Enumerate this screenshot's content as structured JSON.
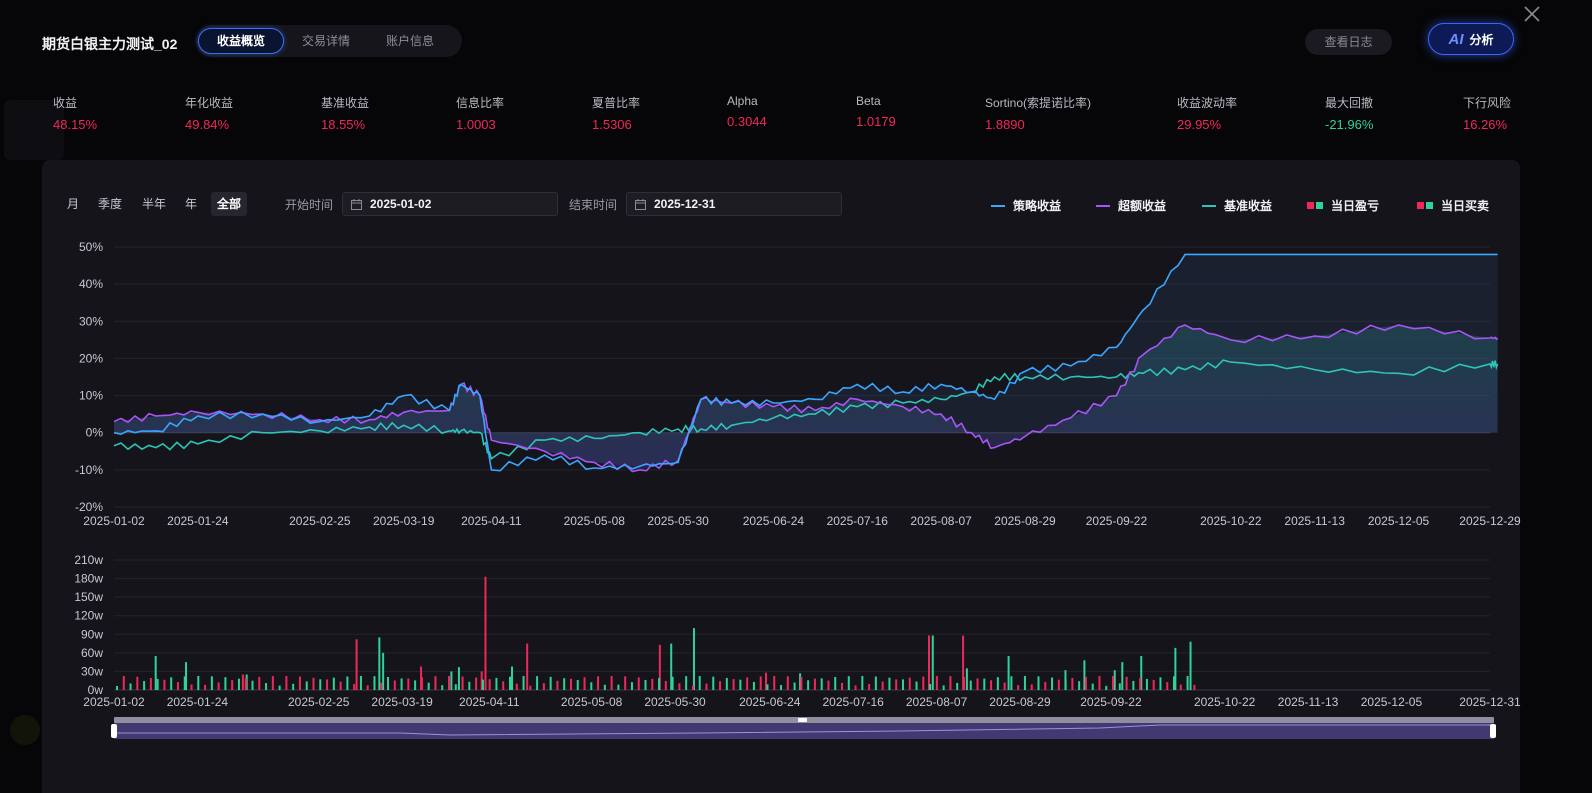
{
  "header": {
    "title": "期货白银主力测试_02",
    "tabs": [
      {
        "label": "收益概览",
        "active": true
      },
      {
        "label": "交易详情",
        "active": false
      },
      {
        "label": "账户信息",
        "active": false
      }
    ],
    "log_button": "查看日志",
    "ai_button": {
      "logo": "AI",
      "label": "分析"
    },
    "close_icon": "close-icon"
  },
  "metrics": [
    {
      "label": "收益",
      "value": "48.15%",
      "tone": "red"
    },
    {
      "label": "年化收益",
      "value": "49.84%",
      "tone": "red"
    },
    {
      "label": "基准收益",
      "value": "18.55%",
      "tone": "red"
    },
    {
      "label": "信息比率",
      "value": "1.0003",
      "tone": "red"
    },
    {
      "label": "夏普比率",
      "value": "1.5306",
      "tone": "red"
    },
    {
      "label": "Alpha",
      "value": "0.3044",
      "tone": "red"
    },
    {
      "label": "Beta",
      "value": "1.0179",
      "tone": "red"
    },
    {
      "label": "Sortino(索提诺比率)",
      "value": "1.8890",
      "tone": "red"
    },
    {
      "label": "收益波动率",
      "value": "29.95%",
      "tone": "red"
    },
    {
      "label": "最大回撤",
      "value": "-21.96%",
      "tone": "green"
    },
    {
      "label": "下行风险",
      "value": "16.26%",
      "tone": "red"
    }
  ],
  "controls": {
    "ranges": [
      {
        "label": "月",
        "active": false
      },
      {
        "label": "季度",
        "active": false
      },
      {
        "label": "半年",
        "active": false
      },
      {
        "label": "年",
        "active": false
      },
      {
        "label": "全部",
        "active": true
      }
    ],
    "start_label": "开始时间",
    "start_value": "2025-01-02",
    "end_label": "结束时间",
    "end_value": "2025-12-31",
    "calendar_icon": "calendar-icon"
  },
  "legend": [
    {
      "label": "策略收益",
      "kind": "line",
      "color": "#3aa6ff"
    },
    {
      "label": "超额收益",
      "kind": "line",
      "color": "#a855f7"
    },
    {
      "label": "基准收益",
      "kind": "line",
      "color": "#2ec4b6"
    },
    {
      "label": "当日盈亏",
      "kind": "squares",
      "colors": [
        "#f0285a",
        "#2fd399"
      ]
    },
    {
      "label": "当日买卖",
      "kind": "squares",
      "colors": [
        "#f0285a",
        "#2fd399"
      ]
    }
  ],
  "colors": {
    "strategy": "#3aa6ff",
    "excess": "#a855f7",
    "benchmark": "#2ec4b6",
    "up": "#f0285a",
    "down": "#2fd399"
  },
  "chart_data": [
    {
      "type": "line",
      "title": "",
      "xlabel": "",
      "ylabel": "",
      "ylim": [
        -20,
        50
      ],
      "y_ticks": [
        "50%",
        "40%",
        "30%",
        "20%",
        "10%",
        "0%",
        "-10%",
        "-20%"
      ],
      "x_ticks": [
        "2025-01-02",
        "2025-01-24",
        "2025-02-25",
        "2025-03-19",
        "2025-04-11",
        "2025-05-08",
        "2025-05-30",
        "2025-06-24",
        "2025-07-16",
        "2025-08-07",
        "2025-08-29",
        "2025-09-22",
        "2025-10-22",
        "2025-11-13",
        "2025-12-05",
        "2025-12-29"
      ],
      "x": [
        "2025-01-02",
        "2025-01-13",
        "2025-01-24",
        "2025-02-10",
        "2025-02-25",
        "2025-03-10",
        "2025-03-19",
        "2025-03-31",
        "2025-04-03",
        "2025-04-08",
        "2025-04-11",
        "2025-04-25",
        "2025-05-08",
        "2025-05-20",
        "2025-05-30",
        "2025-06-05",
        "2025-06-13",
        "2025-06-24",
        "2025-07-05",
        "2025-07-16",
        "2025-07-28",
        "2025-08-07",
        "2025-08-15",
        "2025-08-21",
        "2025-08-29",
        "2025-09-10",
        "2025-09-22",
        "2025-09-29",
        "2025-10-10",
        "2025-10-22",
        "2025-11-13",
        "2025-12-05",
        "2025-12-29",
        "2025-12-31"
      ],
      "series": [
        {
          "name": "策略收益",
          "values": [
            0,
            0.5,
            4.5,
            5,
            3,
            4.5,
            10,
            6,
            13,
            10,
            -10,
            -6,
            -9.5,
            -9,
            -8,
            9,
            8,
            8,
            9,
            13,
            11,
            13,
            11,
            9,
            16.5,
            18,
            23,
            33,
            48,
            48,
            48,
            48,
            48,
            48
          ]
        },
        {
          "name": "超额收益",
          "values": [
            3,
            4.5,
            5.5,
            5,
            3.5,
            3.5,
            5.5,
            6,
            13,
            10,
            -2,
            -5,
            -8,
            -10,
            -7.5,
            9,
            8,
            7,
            6,
            9,
            7,
            5,
            0,
            -4,
            -1,
            4,
            10,
            21,
            29,
            25,
            26,
            29,
            25.5,
            25.5
          ]
        },
        {
          "name": "基准收益",
          "values": [
            -3.5,
            -4,
            -3,
            0,
            0.5,
            1.5,
            2,
            0.5,
            0.5,
            0,
            -7,
            -2,
            -1.5,
            0,
            1,
            1,
            2,
            4,
            5,
            7,
            8,
            9,
            11,
            15,
            15,
            15,
            15,
            16,
            17,
            19,
            17,
            16,
            18.5,
            18.5
          ]
        }
      ]
    },
    {
      "type": "bar",
      "title": "",
      "xlabel": "",
      "ylabel": "",
      "ylim": [
        0,
        210
      ],
      "y_ticks": [
        "210w",
        "180w",
        "150w",
        "120w",
        "90w",
        "60w",
        "30w",
        "0w"
      ],
      "x_ticks": [
        "2025-01-02",
        "2025-01-24",
        "2025-02-25",
        "2025-03-19",
        "2025-04-11",
        "2025-05-08",
        "2025-05-30",
        "2025-06-24",
        "2025-07-16",
        "2025-08-07",
        "2025-08-29",
        "2025-09-22",
        "2025-10-22",
        "2025-11-13",
        "2025-12-05",
        "2025-12-31"
      ],
      "series": [
        {
          "name": "当日买卖",
          "values": [
            {
              "x": "2025-01-13",
              "v": 55,
              "side": "down"
            },
            {
              "x": "2025-01-21",
              "v": 45,
              "side": "down"
            },
            {
              "x": "2025-02-05",
              "v": 25,
              "side": "up"
            },
            {
              "x": "2025-02-06",
              "v": 25,
              "side": "down"
            },
            {
              "x": "2025-03-07",
              "v": 82,
              "side": "up"
            },
            {
              "x": "2025-03-13",
              "v": 85,
              "side": "down"
            },
            {
              "x": "2025-03-14",
              "v": 60,
              "side": "down"
            },
            {
              "x": "2025-03-24",
              "v": 38,
              "side": "up"
            },
            {
              "x": "2025-04-01",
              "v": 30,
              "side": "down"
            },
            {
              "x": "2025-04-03",
              "v": 37,
              "side": "down"
            },
            {
              "x": "2025-04-09",
              "v": 30,
              "side": "up"
            },
            {
              "x": "2025-04-10",
              "v": 183,
              "side": "up"
            },
            {
              "x": "2025-04-17",
              "v": 38,
              "side": "down"
            },
            {
              "x": "2025-04-21",
              "v": 75,
              "side": "up"
            },
            {
              "x": "2025-05-26",
              "v": 73,
              "side": "up"
            },
            {
              "x": "2025-05-29",
              "v": 75,
              "side": "down"
            },
            {
              "x": "2025-06-04",
              "v": 100,
              "side": "down"
            },
            {
              "x": "2025-06-23",
              "v": 28,
              "side": "up"
            },
            {
              "x": "2025-07-02",
              "v": 27,
              "side": "down"
            },
            {
              "x": "2025-08-05",
              "v": 88,
              "side": "up"
            },
            {
              "x": "2025-08-06",
              "v": 88,
              "side": "down"
            },
            {
              "x": "2025-08-14",
              "v": 88,
              "side": "up"
            },
            {
              "x": "2025-08-15",
              "v": 35,
              "side": "down"
            },
            {
              "x": "2025-08-26",
              "v": 55,
              "side": "down"
            },
            {
              "x": "2025-09-10",
              "v": 32,
              "side": "down"
            },
            {
              "x": "2025-09-15",
              "v": 48,
              "side": "down"
            },
            {
              "x": "2025-09-23",
              "v": 32,
              "side": "down"
            },
            {
              "x": "2025-09-25",
              "v": 45,
              "side": "down"
            },
            {
              "x": "2025-09-30",
              "v": 55,
              "side": "down"
            },
            {
              "x": "2025-10-09",
              "v": 68,
              "side": "down"
            },
            {
              "x": "2025-10-13",
              "v": 78,
              "side": "down"
            }
          ]
        }
      ]
    }
  ]
}
